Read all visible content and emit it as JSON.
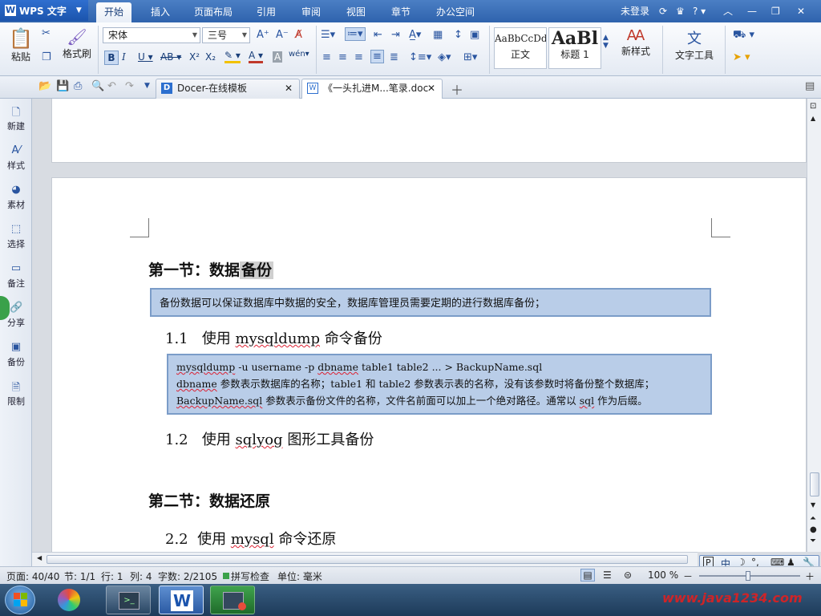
{
  "titlebar": {
    "app_name": "WPS 文字",
    "menu_tabs": [
      "开始",
      "插入",
      "页面布局",
      "引用",
      "审阅",
      "视图",
      "章节",
      "办公空间"
    ],
    "login_text": "未登录"
  },
  "ribbon": {
    "paste_label": "粘贴",
    "format_painter_label": "格式刷",
    "font_name": "宋体",
    "font_size": "三号",
    "style_normal_preview": "AaBbCcDd",
    "style_normal_label": "正文",
    "style_heading_preview": "AaBl",
    "style_heading_label": "标题 1",
    "new_style_label": "新样式",
    "text_tools_label": "文字工具"
  },
  "tabs": {
    "docer_tab": "Docer-在线模板",
    "doc_tab": "《一头扎进M...笔录.doc"
  },
  "sidebar": {
    "items": [
      "新建",
      "样式",
      "素材",
      "选择",
      "备注",
      "分享",
      "备份",
      "限制"
    ]
  },
  "document": {
    "section1_title_plain": "第一节：数据",
    "section1_title_highlight": "备份",
    "section1_note": "备份数据可以保证数据库中数据的安全，数据库管理员需要定期的进行数据库备份；",
    "h_1_1_num": "1.1",
    "h_1_1_pre": "使用",
    "h_1_1_word": "mysqldump",
    "h_1_1_post": "命令备份",
    "code_line1_a": "mysqldump",
    "code_line1_b": " -u username -p ",
    "code_line1_c": "dbname",
    "code_line1_d": " table1 table2 ... > BackupName.sql",
    "code_line2_a": "dbname",
    "code_line2_b": " 参数表示数据库的名称；table1 和 table2 参数表示表的名称，没有该参数时将备份整个数据库；",
    "code_line3_a": "BackupName.sql",
    "code_line3_b": " 参数表示备份文件的名称，文件名前面可以加上一个绝对路径。通常以 ",
    "code_line3_c": "sql",
    "code_line3_d": " 作为后缀。",
    "h_1_2_num": "1.2",
    "h_1_2_pre": "使用",
    "h_1_2_word": "sqlyog",
    "h_1_2_post": "图形工具备份",
    "section2_title": "第二节：数据还原",
    "h_2_2_num": "2.2",
    "h_2_2_pre": "使用",
    "h_2_2_word": "mysql",
    "h_2_2_post": "命令还原"
  },
  "statusbar": {
    "page": "页面: 40/40",
    "section": "节: 1/1",
    "row": "行: 1",
    "col": "列: 4",
    "wordcount": "字数: 2/2105",
    "spellcheck": "拼写检查",
    "unit": "单位: 毫米",
    "zoom": "100 %"
  },
  "ime": {
    "mode": "中"
  }
}
